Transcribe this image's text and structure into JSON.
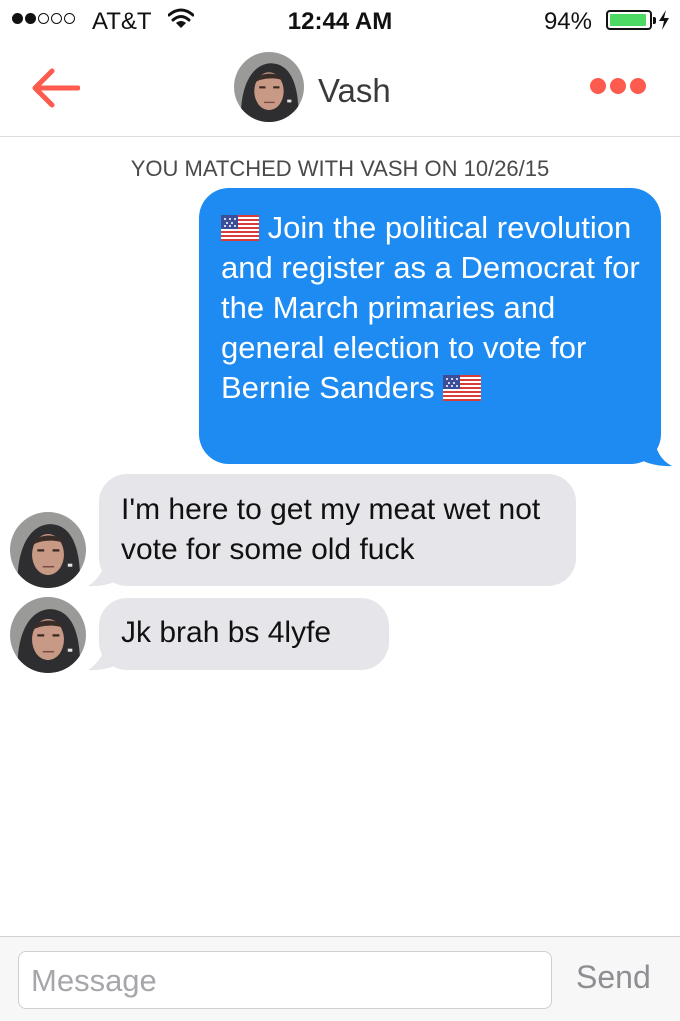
{
  "status_bar": {
    "carrier": "AT&T",
    "time": "12:44 AM",
    "battery": "94%",
    "battery_level": 0.94
  },
  "header": {
    "name": "Vash"
  },
  "conversation": {
    "match_notice": "YOU MATCHED WITH VASH ON 10/26/15",
    "messages": [
      {
        "from": "me",
        "text": "Join the political revolution and register as a Democrat for the March primaries and general election to vote for Bernie Sanders"
      },
      {
        "from": "them",
        "text": "I'm here to get my meat wet not vote for some old fuck"
      },
      {
        "from": "them",
        "text": "Jk brah bs 4lyfe"
      }
    ]
  },
  "composer": {
    "placeholder": "Message",
    "send_label": "Send"
  },
  "colors": {
    "accent": "#fd5b4e",
    "outgoing_bubble": "#1d8bf1",
    "incoming_bubble": "#e5e5ea",
    "battery_fill": "#4cd964"
  }
}
